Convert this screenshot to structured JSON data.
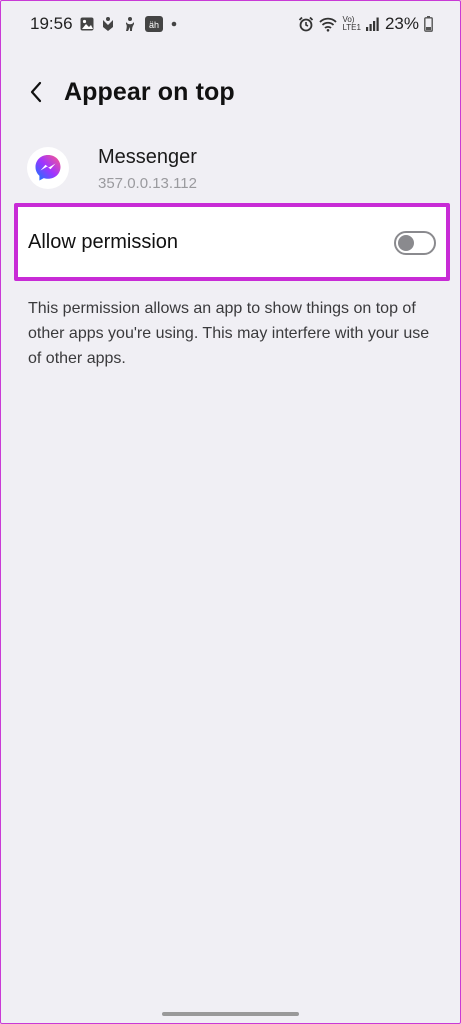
{
  "status_bar": {
    "time": "19:56",
    "battery": "23%",
    "left_icons": [
      "gallery-icon",
      "app-notification-icon",
      "accessibility-icon",
      "ah-app-icon",
      "dot-icon"
    ],
    "right_icons": [
      "alarm-icon",
      "wifi-icon",
      "volte-lte-icon",
      "signal-icon",
      "battery-icon"
    ],
    "network_label_top": "Vo)",
    "network_label_bottom": "LTE1"
  },
  "header": {
    "title": "Appear on top",
    "back_icon": "chevron-left-icon"
  },
  "app": {
    "name": "Messenger",
    "version": "357.0.0.13.112",
    "icon": "messenger-icon"
  },
  "permission": {
    "label": "Allow permission",
    "enabled": false
  },
  "description": "This permission allows an app to show things on top of other apps you're using. This may interfere with your use of other apps.",
  "colors": {
    "background": "#f0eff4",
    "highlight_border": "#c82bd6",
    "toggle_off": "#8a8a8e",
    "messenger_gradient_start": "#0a7cff",
    "messenger_gradient_end": "#ff5c87"
  }
}
